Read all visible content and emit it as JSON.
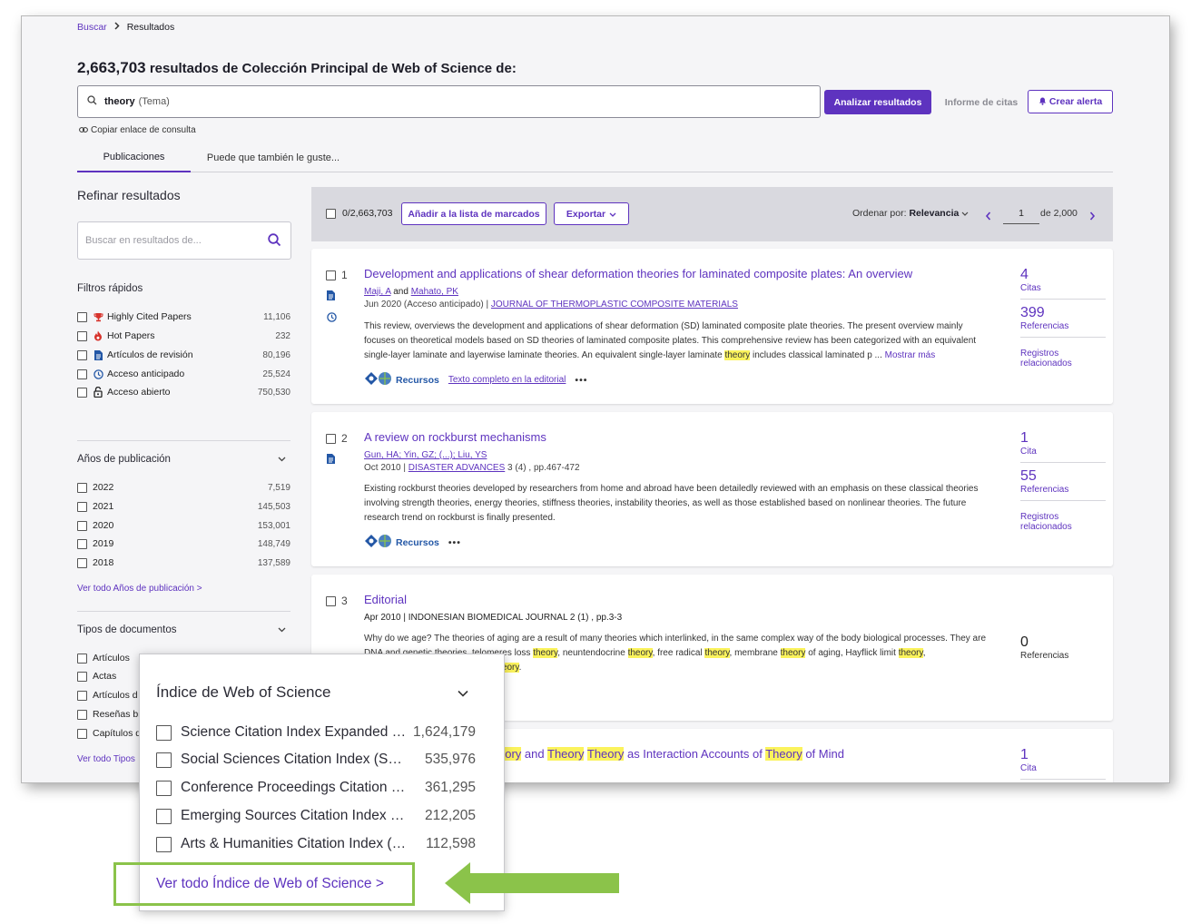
{
  "breadcrumb": {
    "search": "Buscar",
    "current": "Resultados"
  },
  "header": {
    "count": "2,663,703",
    "text": "resultados de Colección Principal de Web of Science de:",
    "query_term": "theory",
    "query_field": "(Tema)",
    "analyze": "Analizar resultados",
    "citation_report": "Informe de citas",
    "create_alert": "Crear alerta",
    "copy_link": "Copiar enlace de consulta"
  },
  "tabs": [
    "Publicaciones",
    "Puede que también le guste..."
  ],
  "sidebar": {
    "title": "Refinar resultados",
    "search_placeholder": "Buscar en resultados de...",
    "quick_filters_title": "Filtros rápidos",
    "quick_filters": [
      {
        "label": "Highly Cited Papers",
        "count": "11,106",
        "icon": "trophy-icon"
      },
      {
        "label": "Hot Papers",
        "count": "232",
        "icon": "flame-icon"
      },
      {
        "label": "Artículos de revisión",
        "count": "80,196",
        "icon": "document-icon"
      },
      {
        "label": "Acceso anticipado",
        "count": "25,524",
        "icon": "clock-icon"
      },
      {
        "label": "Acceso abierto",
        "count": "750,530",
        "icon": "unlock-icon"
      }
    ],
    "years_title": "Años de publicación",
    "years": [
      {
        "label": "2022",
        "count": "7,519"
      },
      {
        "label": "2021",
        "count": "145,503"
      },
      {
        "label": "2020",
        "count": "153,001"
      },
      {
        "label": "2019",
        "count": "148,749"
      },
      {
        "label": "2018",
        "count": "137,589"
      }
    ],
    "years_link": "Ver todo Años de publicación >",
    "doctypes_title": "Tipos de documentos",
    "doctypes": [
      "Artículos",
      "Actas",
      "Artículos d",
      "Reseñas bi",
      "Capítulos d"
    ],
    "doctypes_link": "Ver todo Tipos"
  },
  "toolbar": {
    "selected": "0/2,663,703",
    "add_marked": "Añadir a la lista de marcados",
    "export": "Exportar",
    "sort_label": "Ordenar por:",
    "sort_value": "Relevancia",
    "page": "1",
    "of_pages": "de  2,000"
  },
  "results": [
    {
      "num": "1",
      "title": "Development and applications of shear deformation theories for laminated composite plates: An overview",
      "author1": "Maji, A",
      "and": "and",
      "author2": "Mahato, PK",
      "date": "Jun 2020 (Acceso anticipado) |",
      "journal": "JOURNAL OF THERMOPLASTIC COMPOSITE MATERIALS",
      "abs1": "This review, overviews the development and applications of shear deformation (SD) laminated composite plate theories. The present overview mainly",
      "abs2": "focuses on theoretical models based on SD theories of laminated composite plates. This comprehensive review has been categorized with an equivalent",
      "abs3a": "single-layer laminate and layerwise laminate theories. An equivalent single-layer laminate",
      "abs3hl": "theory",
      "abs3b": "includes classical laminated p ...",
      "more": "Mostrar más",
      "recursos": "Recursos",
      "fulltext": "Texto completo en la editorial",
      "cites": "4",
      "cites_label": "Citas",
      "refs": "399",
      "refs_label": "Referencias",
      "related1": "Registros",
      "related2": "relacionados"
    },
    {
      "num": "2",
      "title": "A review on rockburst mechanisms",
      "authors": "Gun, HA; Yin, GZ; (...); Liu, YS",
      "date": "Oct 2010 |",
      "journal": "DISASTER ADVANCES",
      "volume": "3 (4) , pp.467-472",
      "abs1": "Existing rockburst theories developed by researchers from home and abroad have been detailedly reviewed with an emphasis on these classical theories",
      "abs2": "involving strength theories, energy theories, stiffness theories, instability theories, as well as those established based on nonlinear theories. The future",
      "abs3": "research trend on rockburst is finally presented.",
      "recursos": "Recursos",
      "cites": "1",
      "cites_label": "Cita",
      "refs": "55",
      "refs_label": "Referencias",
      "related1": "Registros",
      "related2": "relacionados"
    },
    {
      "num": "3",
      "title": "Editorial",
      "date": "Apr 2010 | INDONESIAN BIOMEDICAL JOURNAL 2 (1) , pp.3-3",
      "abs1": "Why do we age? The theories of aging are a result of many theories which interlinked, in the same complex way of the body biological processes. They are",
      "abs2a": "DNA and genetic theories, telomeres loss",
      "hl": "theory",
      "abs2b": ", neuntendocrine",
      "abs2c": ", free radical",
      "abs2d": ", membrane",
      "abs2e": "of aging, Hayflick limit",
      "abs3": "g",
      "refs": "0",
      "refs_label": "Referencias"
    },
    {
      "title_a": "eory",
      "title_and": "and",
      "title_hl": "Theory",
      "title_mid": "as Interaction Accounts of",
      "title_end": "of Mind",
      "cites": "1",
      "cites_label": "Cita"
    }
  ],
  "popup": {
    "title": "Índice de Web of Science",
    "items": [
      {
        "label": "Science Citation Index Expanded (SCI-EXPANDED)",
        "count": "1,624,179"
      },
      {
        "label": "Social Sciences Citation Index (SSCI)",
        "count": "535,976"
      },
      {
        "label": "Conference Proceedings Citation Index",
        "count": "361,295"
      },
      {
        "label": "Emerging Sources Citation Index (ESCI)",
        "count": "212,205"
      },
      {
        "label": "Arts & Humanities Citation Index (A&HCI)",
        "count": "112,598"
      }
    ],
    "link": "Ver todo Índice de Web of Science >"
  },
  "colors": {
    "accent": "#5e33bf",
    "highlight": "#fbf35c",
    "callout": "#8bc34a"
  }
}
